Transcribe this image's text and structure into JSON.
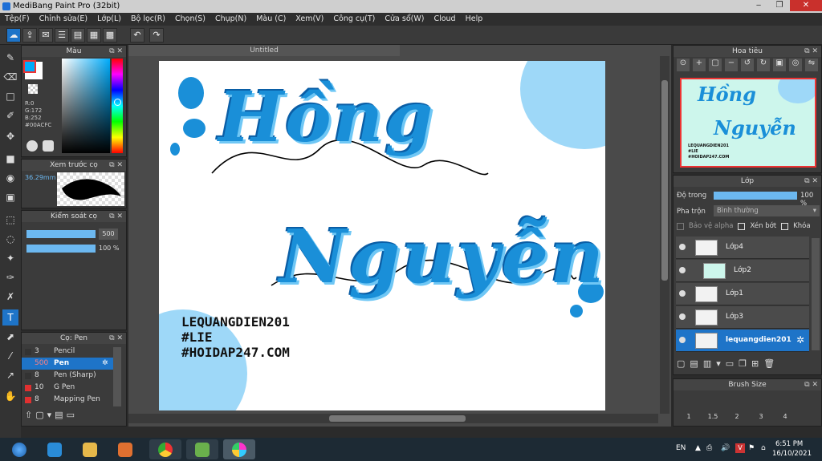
{
  "window": {
    "title": "MediBang Paint Pro (32bit)"
  },
  "menu": [
    "Tệp(F)",
    "Chỉnh sửa(E)",
    "Lớp(L)",
    "Bộ lọc(R)",
    "Chọn(S)",
    "Chụp(N)",
    "Màu (C)",
    "Xem(V)",
    "Công cụ(T)",
    "Cửa sổ(W)",
    "Cloud",
    "Help"
  ],
  "color_panel": {
    "title": "Màu",
    "r": "R:0",
    "g": "G:172",
    "b": "B:252",
    "hex": "#00ACFC",
    "current_color": "#00ACFC"
  },
  "preview_panel": {
    "title": "Xem trước cọ",
    "size": "36.29mm"
  },
  "control_panel": {
    "title": "Kiểm soát cọ",
    "size_value": "500",
    "opacity_value": "100 %"
  },
  "brush_panel": {
    "title": "Cọ: Pen",
    "items": [
      {
        "size": "3",
        "name": "Pencil",
        "color": "#333333"
      },
      {
        "size": "500",
        "name": "Pen",
        "color": "#1e74c8"
      },
      {
        "size": "8",
        "name": "Pen (Sharp)",
        "color": "#333333"
      },
      {
        "size": "10",
        "name": "G Pen",
        "color": "#e03030"
      },
      {
        "size": "8",
        "name": "Mapping Pen",
        "color": "#e03030"
      }
    ]
  },
  "document": {
    "tab": "Untitled"
  },
  "canvas_art": {
    "line1": "Hồng",
    "line2": "Nguyễn",
    "credit": [
      "LEQUANGDIEN201",
      "#LIE",
      "#HOIDAP247.COM"
    ],
    "text_color": "#1a8fd8"
  },
  "navigator": {
    "title": "Hoa tiêu"
  },
  "layer_panel": {
    "title": "Lớp",
    "opacity_label": "Độ trong",
    "opacity_value": "100 %",
    "blend_label": "Pha trộn",
    "blend_value": "Bình thường",
    "protect_alpha": "Bảo vệ alpha",
    "clipping": "Xén bớt",
    "lock": "Khóa",
    "layers": [
      "Lớp4",
      "Lớp2",
      "Lớp1",
      "Lớp3",
      "lequangdien201"
    ]
  },
  "brush_size_panel": {
    "title": "Brush Size",
    "sizes": [
      "1",
      "1.5",
      "2",
      "3",
      "4"
    ]
  },
  "taskbar": {
    "lang": "EN",
    "time": "6:51 PM",
    "date": "16/10/2021"
  }
}
